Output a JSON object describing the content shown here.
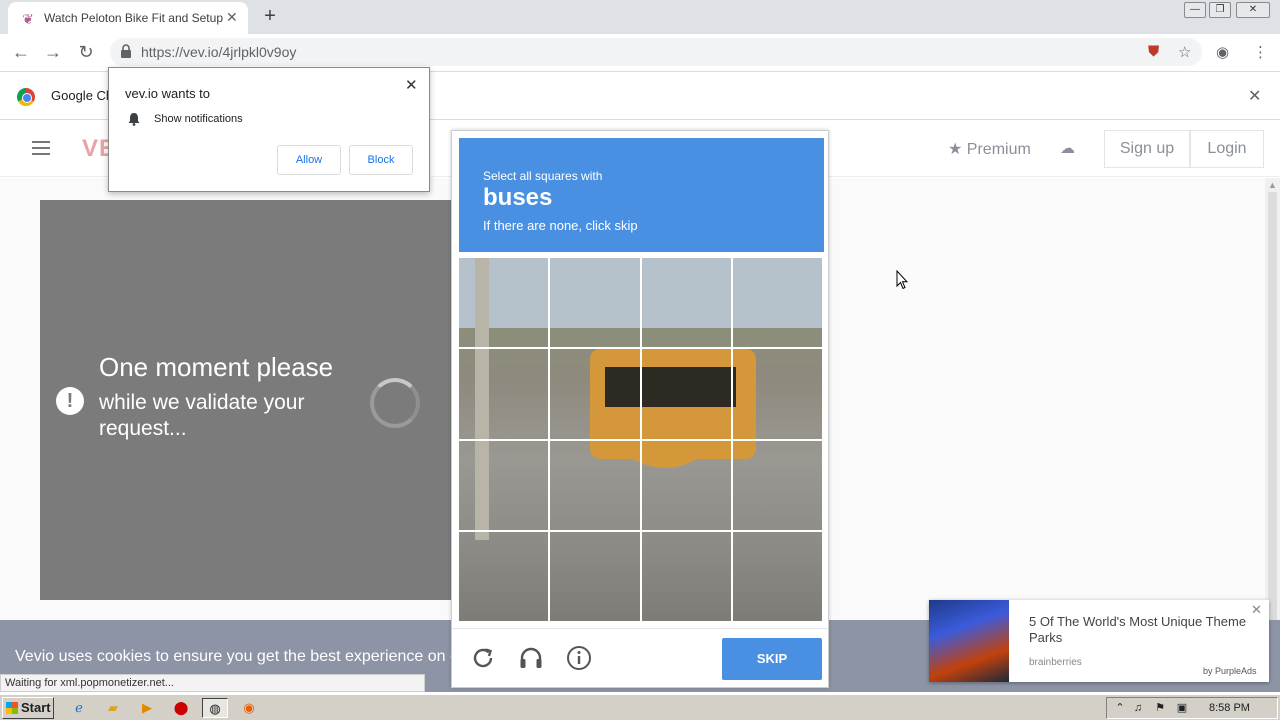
{
  "browser": {
    "tab_title": "Watch Peloton Bike Fit and Setup wi",
    "tab_close": "✕",
    "new_tab": "+",
    "url": "https://vev.io/4jrlpkl0v9oy",
    "window_min": "—",
    "window_restore": "❐",
    "window_close": "✕"
  },
  "infobar": {
    "text": "Google Ch",
    "close": "✕"
  },
  "notification_popup": {
    "heading": "vev.io wants to",
    "permission": "Show notifications",
    "allow": "Allow",
    "block": "Block",
    "close": "✕"
  },
  "site": {
    "logo": "VE",
    "premium": "Premium",
    "signup": "Sign up",
    "login": "Login"
  },
  "player": {
    "message_line1": "One moment please",
    "message_line2": "while we validate your request..."
  },
  "captcha": {
    "instruction": "Select all squares with",
    "target": "buses",
    "hint": "If there are none, click skip",
    "skip": "SKIP",
    "grid_size": 4
  },
  "cookie_bar": {
    "text": "Vevio uses cookies to ensure you get the best experience on c"
  },
  "status_bar": {
    "text": "Waiting for xml.popmonetizer.net..."
  },
  "ad": {
    "title": "5 Of The World's Most Unique Theme Parks",
    "source": "brainberries",
    "by": "by PurpleAds"
  },
  "taskbar": {
    "start": "Start",
    "time": "8:58 PM"
  },
  "colors": {
    "captcha_blue": "#4a90e2",
    "cookie_bar": "#8d94a6",
    "player_gray": "#7b7b7b"
  }
}
